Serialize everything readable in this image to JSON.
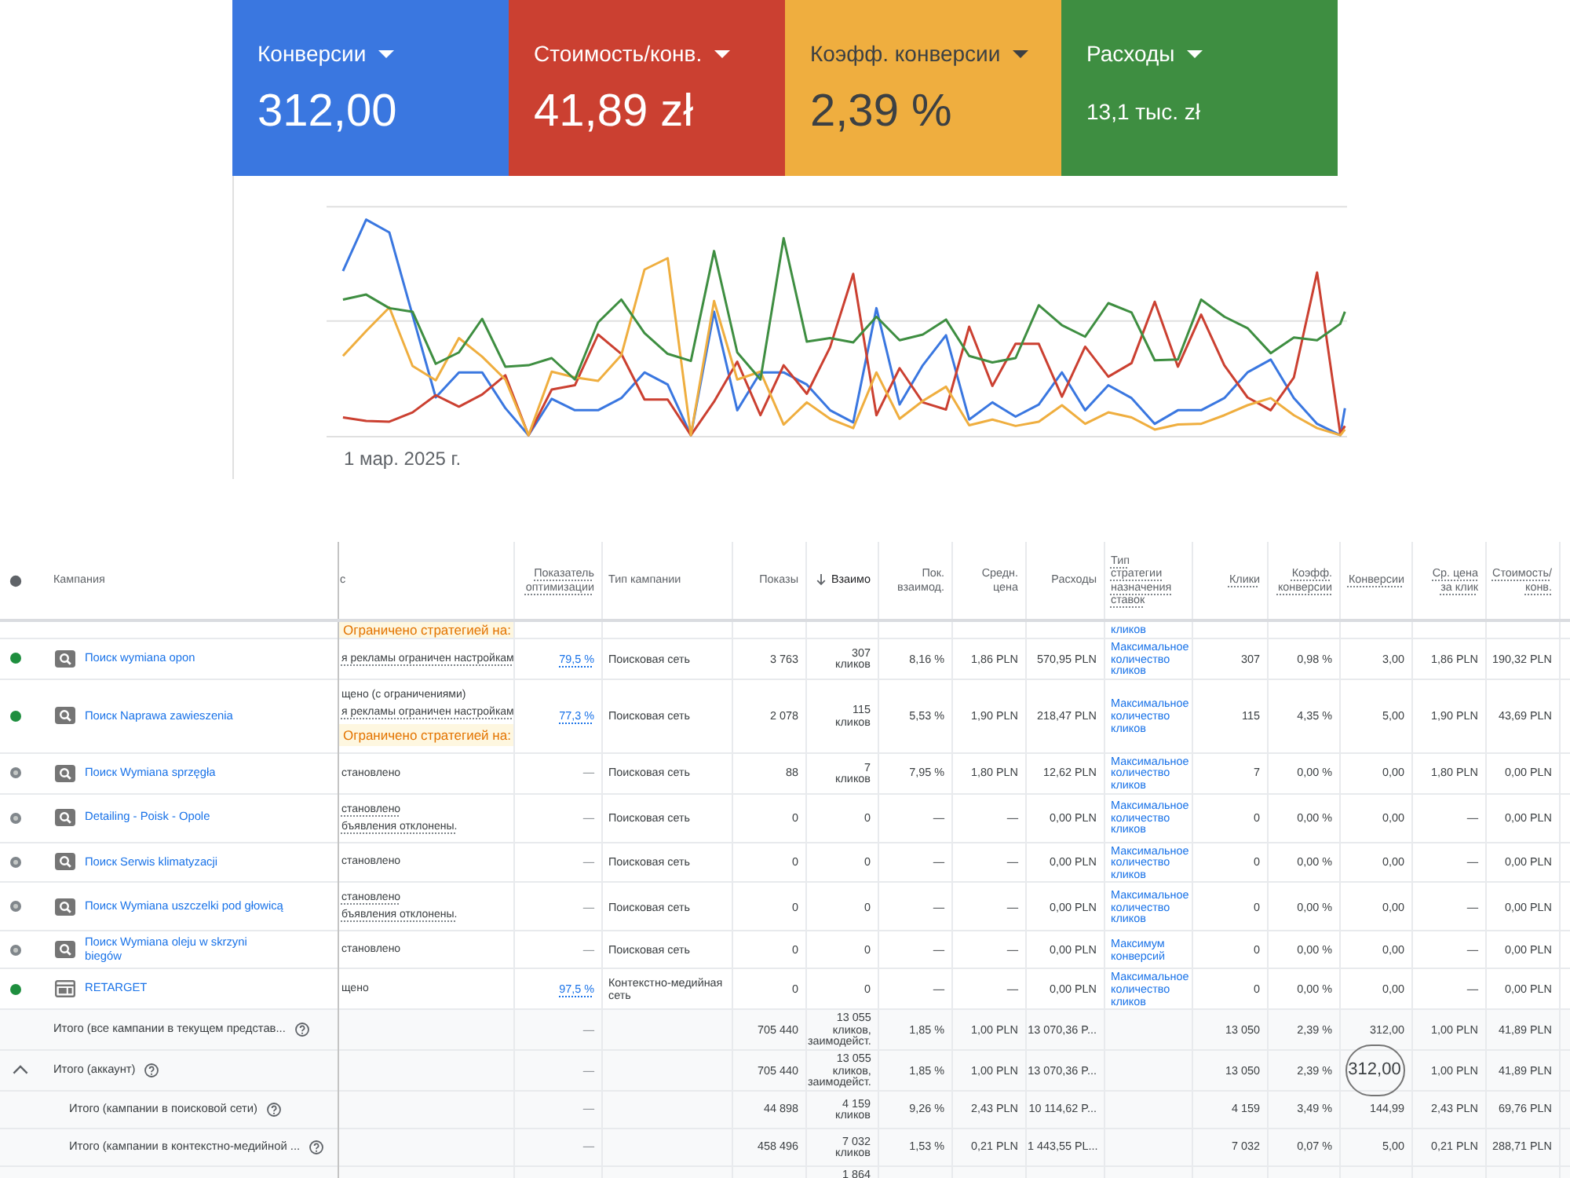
{
  "metrics": [
    {
      "label": "Конверсии",
      "value": "312,00",
      "color": "#3a77e0",
      "compact": false
    },
    {
      "label": "Стоимость/конв.",
      "value": "41,89 zł",
      "color": "#cb4031",
      "compact": false
    },
    {
      "label": "Коэфф. конверсии",
      "value": "2,39 %",
      "color": "#efae3f",
      "compact": false
    },
    {
      "label": "Расходы",
      "value": "13,1 тыс. zł",
      "color": "#3e8e41",
      "compact": true
    }
  ],
  "chart": {
    "x_label": "1 мар. 2025 г."
  },
  "table": {
    "columns": [
      {
        "label": "Кампания",
        "sorted": false,
        "tooltip": false
      },
      {
        "label": "с",
        "sorted": false,
        "tooltip": false
      },
      {
        "label": "Показатель\nоптимизации",
        "sorted": false,
        "tooltip": true
      },
      {
        "label": "Тип кампании",
        "sorted": false,
        "tooltip": false
      },
      {
        "label": "Показы",
        "sorted": false,
        "tooltip": false
      },
      {
        "label": "Взаимо",
        "sorted": true,
        "tooltip": false
      },
      {
        "label": "Пок.\nвзаимод.",
        "sorted": false,
        "tooltip": false
      },
      {
        "label": "Средн.\nцена",
        "sorted": false,
        "tooltip": false
      },
      {
        "label": "Расходы",
        "sorted": false,
        "tooltip": false
      },
      {
        "label": "Тип\nстратегии\nназначения\nставок",
        "sorted": false,
        "tooltip": true
      },
      {
        "label": "Клики",
        "sorted": false,
        "tooltip": true
      },
      {
        "label": "Коэфф.\nконверсии",
        "sorted": false,
        "tooltip": true
      },
      {
        "label": "Конверсии",
        "sorted": false,
        "tooltip": true
      },
      {
        "label": "Ср. цена\nза клик",
        "sorted": false,
        "tooltip": true
      },
      {
        "label": "Стоимость/\nконв.",
        "sorted": false,
        "tooltip": true
      }
    ],
    "partial_top_row": {
      "status": [
        {
          "kind": "badge",
          "text": "Ограничено стратегией на:",
          "tooltip": false
        }
      ],
      "bid_strategy_type": "кликов"
    },
    "rows": [
      {
        "kind": "search",
        "enabled": true,
        "name": "Поиск wymiana opon",
        "status": [
          {
            "kind": "text",
            "text": "я рекламы ограничен настройкам",
            "tooltip": true
          }
        ],
        "optimization_score": {
          "text": "79,5 %",
          "link": true
        },
        "campaign_type": "Поисковая сеть",
        "impressions": "3 763",
        "interactions": "307\nкликов",
        "interaction_rate": "8,16 %",
        "avg_cost": "1,86 PLN",
        "cost": "570,95 PLN",
        "bid_strategy_type": "Максимальное\nколичество\nкликов",
        "clicks": "307",
        "conv_rate": "0,98 %",
        "conversions": "3,00",
        "avg_cpc": "1,86 PLN",
        "cost_per_conv": "190,32 PLN"
      },
      {
        "kind": "search",
        "enabled": true,
        "name": "Поиск Naprawa zawieszenia",
        "status": [
          {
            "kind": "text",
            "text": "щено (с ограничениями)",
            "tooltip": false
          },
          {
            "kind": "text",
            "text": "я рекламы ограничен настройкам",
            "tooltip": true
          },
          {
            "kind": "badge",
            "text": "Ограничено стратегией на:",
            "tooltip": false
          }
        ],
        "optimization_score": {
          "text": "77,3 %",
          "link": true
        },
        "campaign_type": "Поисковая сеть",
        "impressions": "2 078",
        "interactions": "115\nкликов",
        "interaction_rate": "5,53 %",
        "avg_cost": "1,90 PLN",
        "cost": "218,47 PLN",
        "bid_strategy_type": "Максимальное\nколичество\nкликов",
        "clicks": "115",
        "conv_rate": "4,35 %",
        "conversions": "5,00",
        "avg_cpc": "1,90 PLN",
        "cost_per_conv": "43,69 PLN"
      },
      {
        "kind": "search",
        "enabled": false,
        "name": "Поиск Wymiana sprzęgła",
        "status": [
          {
            "kind": "text",
            "text": "становлено",
            "tooltip": false
          }
        ],
        "optimization_score": {
          "text": "—",
          "link": false
        },
        "campaign_type": "Поисковая сеть",
        "impressions": "88",
        "interactions": "7\nкликов",
        "interaction_rate": "7,95 %",
        "avg_cost": "1,80 PLN",
        "cost": "12,62 PLN",
        "bid_strategy_type": "Максимальное\nколичество\nкликов",
        "clicks": "7",
        "conv_rate": "0,00 %",
        "conversions": "0,00",
        "avg_cpc": "1,80 PLN",
        "cost_per_conv": "0,00 PLN"
      },
      {
        "kind": "search",
        "enabled": false,
        "name": "Detailing - Poisk - Opole",
        "status": [
          {
            "kind": "text",
            "text": "становлено",
            "tooltip": true
          },
          {
            "kind": "text",
            "text": "бъявления отклонены.",
            "tooltip": true
          }
        ],
        "optimization_score": {
          "text": "—",
          "link": false
        },
        "campaign_type": "Поисковая сеть",
        "impressions": "0",
        "interactions": "0",
        "interaction_rate": "—",
        "avg_cost": "—",
        "cost": "0,00 PLN",
        "bid_strategy_type": "Максимальное\nколичество\nкликов",
        "clicks": "0",
        "conv_rate": "0,00 %",
        "conversions": "0,00",
        "avg_cpc": "—",
        "cost_per_conv": "0,00 PLN"
      },
      {
        "kind": "search",
        "enabled": false,
        "name": "Поиск Serwis klimatyzacji",
        "status": [
          {
            "kind": "text",
            "text": "становлено",
            "tooltip": false
          }
        ],
        "optimization_score": {
          "text": "—",
          "link": false
        },
        "campaign_type": "Поисковая сеть",
        "impressions": "0",
        "interactions": "0",
        "interaction_rate": "—",
        "avg_cost": "—",
        "cost": "0,00 PLN",
        "bid_strategy_type": "Максимальное\nколичество\nкликов",
        "clicks": "0",
        "conv_rate": "0,00 %",
        "conversions": "0,00",
        "avg_cpc": "—",
        "cost_per_conv": "0,00 PLN"
      },
      {
        "kind": "search",
        "enabled": false,
        "name": "Поиск Wymiana uszczelki pod głowicą",
        "status": [
          {
            "kind": "text",
            "text": "становлено",
            "tooltip": true
          },
          {
            "kind": "text",
            "text": "бъявления отклонены.",
            "tooltip": true
          }
        ],
        "optimization_score": {
          "text": "—",
          "link": false
        },
        "campaign_type": "Поисковая сеть",
        "impressions": "0",
        "interactions": "0",
        "interaction_rate": "—",
        "avg_cost": "—",
        "cost": "0,00 PLN",
        "bid_strategy_type": "Максимальное\nколичество\nкликов",
        "clicks": "0",
        "conv_rate": "0,00 %",
        "conversions": "0,00",
        "avg_cpc": "—",
        "cost_per_conv": "0,00 PLN"
      },
      {
        "kind": "search",
        "enabled": false,
        "name": "Поиск Wymiana oleju w skrzyni\nbiegów",
        "status": [
          {
            "kind": "text",
            "text": "становлено",
            "tooltip": false
          }
        ],
        "optimization_score": {
          "text": "—",
          "link": false
        },
        "campaign_type": "Поисковая сеть",
        "impressions": "0",
        "interactions": "0",
        "interaction_rate": "—",
        "avg_cost": "—",
        "cost": "0,00 PLN",
        "bid_strategy_type": "Максимум\nконверсий",
        "clicks": "0",
        "conv_rate": "0,00 %",
        "conversions": "0,00",
        "avg_cpc": "—",
        "cost_per_conv": "0,00 PLN"
      },
      {
        "kind": "display",
        "enabled": true,
        "name": "RETARGET",
        "status": [
          {
            "kind": "text",
            "text": "щено",
            "tooltip": false
          }
        ],
        "optimization_score": {
          "text": "97,5 %",
          "link": true
        },
        "campaign_type": "Контекстно-медийная\nсеть",
        "impressions": "0",
        "interactions": "0",
        "interaction_rate": "—",
        "avg_cost": "—",
        "cost": "0,00 PLN",
        "bid_strategy_type": "Максимальное\nколичество\nкликов",
        "clicks": "0",
        "conv_rate": "0,00 %",
        "conversions": "0,00",
        "avg_cpc": "—",
        "cost_per_conv": "0,00 PLN"
      }
    ],
    "totals": [
      {
        "label": "Итого (все кампании в текущем представ...",
        "cells": {
          "optimization_score": {
            "text": "—",
            "link": false
          },
          "impressions": "705 440",
          "interactions": "13 055\nкликов,\nзаимодейст.",
          "interaction_rate": "1,85 %",
          "avg_cost": "1,00 PLN",
          "cost": "13 070,36 P...",
          "clicks": "13 050",
          "conv_rate": "2,39 %",
          "conversions": "312,00",
          "avg_cpc": "1,00 PLN",
          "cost_per_conv": "41,89 PLN"
        }
      },
      {
        "label": "Итого (аккаунт)",
        "expanded": true,
        "cells": {
          "optimization_score": {
            "text": "—",
            "link": false
          },
          "impressions": "705 440",
          "interactions": "13 055\nкликов,\nзаимодейст.",
          "interaction_rate": "1,85 %",
          "avg_cost": "1,00 PLN",
          "cost": "13 070,36 P...",
          "clicks": "13 050",
          "conv_rate": "2,39 %",
          "conversions": {
            "text": "312,00",
            "circled": true
          },
          "avg_cpc": "1,00 PLN",
          "cost_per_conv": "41,89 PLN"
        },
        "children": [
          {
            "label": "Итого (кампании в поисковой сети)",
            "cells": {
              "optimization_score": {
                "text": "—",
                "link": false
              },
              "impressions": "44 898",
              "interactions": "4 159\nкликов",
              "interaction_rate": "9,26 %",
              "avg_cost": "2,43 PLN",
              "cost": "10 114,62 P...",
              "clicks": "4 159",
              "conv_rate": "3,49 %",
              "conversions": "144,99",
              "avg_cpc": "2,43 PLN",
              "cost_per_conv": "69,76 PLN"
            }
          },
          {
            "label": "Итого (кампании в контекстно-медийной ...",
            "cells": {
              "optimization_score": {
                "text": "—",
                "link": false
              },
              "impressions": "458 496",
              "interactions": "7 032\nкликов",
              "interaction_rate": "1,53 %",
              "avg_cost": "0,21 PLN",
              "cost": "1 443,55 PL...",
              "clicks": "7 032",
              "conv_rate": "0,07 %",
              "conversions": "5,00",
              "avg_cpc": "0,21 PLN",
              "cost_per_conv": "288,71 PLN"
            }
          },
          {
            "cells": {
              "interactions": "1 864"
            }
          }
        ]
      }
    ]
  }
}
